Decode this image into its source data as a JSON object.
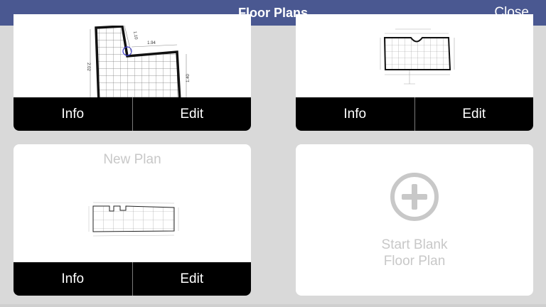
{
  "header": {
    "title": "Floor Plans",
    "close_label": "Close"
  },
  "plans": [
    {
      "name": "",
      "info_label": "Info",
      "edit_label": "Edit",
      "dim_top": "1.94",
      "dim_left": "2.02",
      "dim_right": "1.40",
      "dim_small": "1.10"
    },
    {
      "name": "",
      "info_label": "Info",
      "edit_label": "Edit"
    },
    {
      "name": "New Plan",
      "info_label": "Info",
      "edit_label": "Edit"
    }
  ],
  "new_plan_card": {
    "line1": "Start Blank",
    "line2": "Floor Plan"
  },
  "colors": {
    "nav_bar": "#4a5891",
    "background": "#d9d9d9",
    "action_bar": "#000000",
    "muted_text": "#c8c8c8"
  },
  "icons": {
    "add": "plus-circle-icon"
  }
}
